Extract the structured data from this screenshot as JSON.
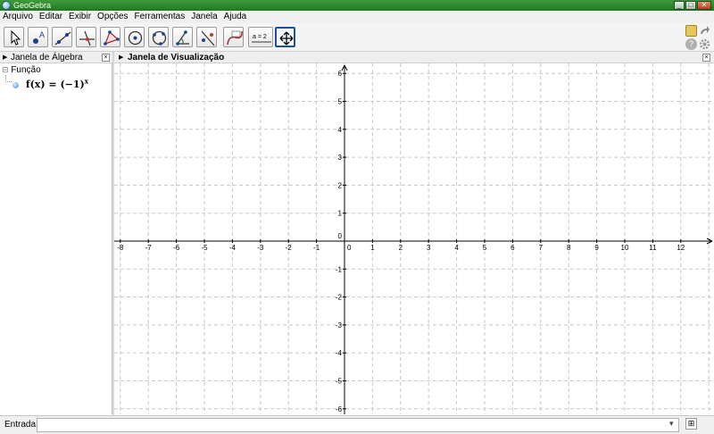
{
  "window": {
    "title": "GeoGebra",
    "btn_min": "_",
    "btn_max": "□",
    "btn_close": "✕"
  },
  "menu": [
    "Arquivo",
    "Editar",
    "Exibir",
    "Opções",
    "Ferramentas",
    "Janela",
    "Ajuda"
  ],
  "toolbar": {
    "tools": [
      "move-tool",
      "point-tool",
      "line-tool",
      "perpendicular-tool",
      "polygon-tool",
      "circle-tool",
      "ellipse-tool",
      "angle-tool",
      "reflect-tool",
      "slider-tool",
      "input-box-tool",
      "move-graphics-tool"
    ],
    "active": "move-graphics-tool",
    "point_label": "A",
    "slider_label": "a = 2",
    "right_icons": [
      "undo-icon",
      "redo-icon",
      "help-icon",
      "settings-icon"
    ]
  },
  "algebra": {
    "header": "Janela de Álgebra",
    "group": "Função",
    "expand_glyph": "⊟",
    "item_lhs": "f(x)",
    "item_eq": "=",
    "item_base": "(−1)",
    "item_exp": "x",
    "close": "×"
  },
  "graphics": {
    "header": "Janela de Visualização",
    "close": "×",
    "x_range": [
      -8,
      12
    ],
    "y_range": [
      -6,
      6
    ],
    "x_ticks": [
      "-8",
      "-7",
      "-6",
      "-5",
      "-4",
      "-3",
      "-2",
      "-1",
      "0",
      "1",
      "2",
      "3",
      "4",
      "5",
      "6",
      "7",
      "8",
      "9",
      "10",
      "11",
      "12"
    ],
    "y_ticks": [
      "6",
      "5",
      "4",
      "3",
      "2",
      "1",
      "0",
      "-1",
      "-2",
      "-3",
      "-4",
      "-5",
      "-6"
    ],
    "grid": true,
    "colors": {
      "grid": "#c8c8c8",
      "axes": "#000000"
    }
  },
  "inputbar": {
    "label": "Entrada:",
    "value": "",
    "dropdown": "▾",
    "button": "⊞"
  }
}
